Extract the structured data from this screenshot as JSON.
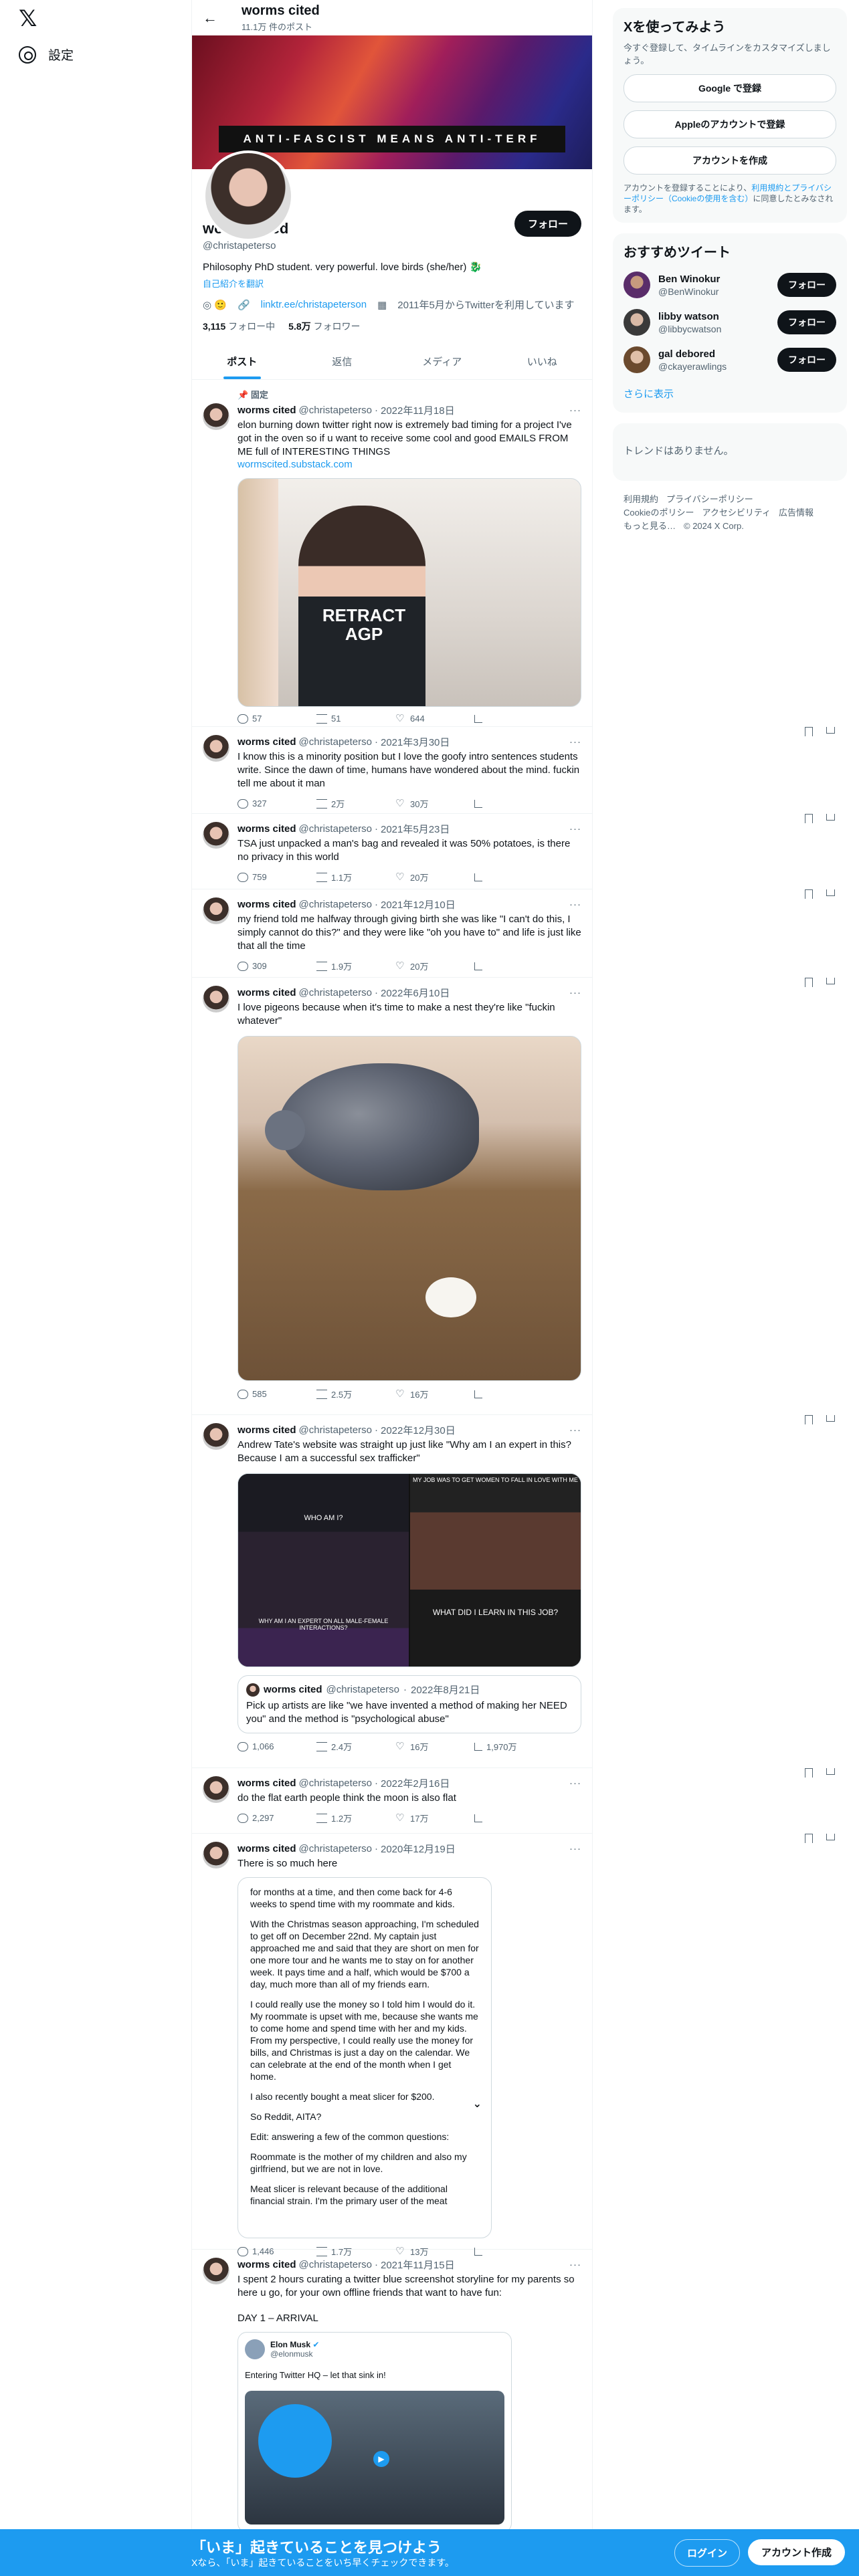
{
  "nav": {
    "settings_label": "設定"
  },
  "header": {
    "name": "worms cited",
    "post_count": "11.1万 件のポスト"
  },
  "banner": {
    "text": "ANTI-FASCIST MEANS ANTI-TERF"
  },
  "profile": {
    "name": "worms cited",
    "handle": "@christapeterso",
    "bio": "Philosophy PhD student. very powerful. love birds (she/her) 🐉",
    "translate": "自己紹介を翻訳",
    "link": "linktr.ee/christapeterson",
    "joined": "2011年5月からTwitterを利用しています",
    "following_count": "3,115",
    "following_label": "フォロー中",
    "followers_count": "5.8万",
    "followers_label": "フォロワー",
    "follow_button": "フォロー"
  },
  "tabs": [
    "ポスト",
    "返信",
    "メディア",
    "いいね"
  ],
  "pinned_label": "固定",
  "tweets": [
    {
      "name": "worms cited",
      "handle": "@christapeterso",
      "date": "2022年11月18日",
      "text": "elon burning down twitter right now is extremely bad timing for a project I've got in the oven so if u want to receive some cool and good EMAILS FROM ME full of INTERESTING THINGS",
      "link": "wormscited.substack.com",
      "image_text": "RETRACT\nAGP",
      "replies": "57",
      "retweets": "51",
      "likes": "644"
    },
    {
      "name": "worms cited",
      "handle": "@christapeterso",
      "date": "2021年3月30日",
      "text": "I know this is a minority position but I love the goofy intro sentences students write. Since the dawn of time, humans have wondered about the mind. fuckin tell me about it man",
      "replies": "327",
      "retweets": "2万",
      "likes": "30万"
    },
    {
      "name": "worms cited",
      "handle": "@christapeterso",
      "date": "2021年5月23日",
      "text": "TSA just unpacked a man's bag and revealed it was 50% potatoes, is there no privacy in this world",
      "replies": "759",
      "retweets": "1.1万",
      "likes": "20万"
    },
    {
      "name": "worms cited",
      "handle": "@christapeterso",
      "date": "2021年12月10日",
      "text": "my friend told me halfway through giving birth she was like \"I can't do this, I simply cannot do this?\" and they were like \"oh you have to\" and life is just like that all the time",
      "replies": "309",
      "retweets": "1.9万",
      "likes": "20万"
    },
    {
      "name": "worms cited",
      "handle": "@christapeterso",
      "date": "2022年6月10日",
      "text": "I love pigeons because when it's time to make a nest they're like \"fuckin whatever\"",
      "replies": "585",
      "retweets": "2.5万",
      "likes": "16万"
    },
    {
      "name": "worms cited",
      "handle": "@christapeterso",
      "date": "2022年12月30日",
      "text": "Andrew Tate's website was straight up just like \"Why am I an expert in this? Because I am a successful sex trafficker\"",
      "media_left_title": "WHO AM I?",
      "media_left_caption": "WHY AM I AN EXPERT ON ALL MALE-FEMALE INTERACTIONS?",
      "media_right_title": "MY JOB WAS TO GET WOMEN TO FALL IN LOVE WITH ME",
      "media_right_caption": "WHAT DID I LEARN IN THIS JOB?",
      "quote": {
        "name": "worms cited",
        "handle": "@christapeterso",
        "date": "2022年8月21日",
        "text": "Pick up artists are like \"we have invented a method of making her NEED you\" and the method is \"psychological abuse\""
      },
      "replies": "1,066",
      "retweets": "2.4万",
      "likes": "16万",
      "views": "1,970万"
    },
    {
      "name": "worms cited",
      "handle": "@christapeterso",
      "date": "2022年2月16日",
      "text": "do the flat earth people think the moon is also flat",
      "replies": "2,297",
      "retweets": "1.2万",
      "likes": "17万"
    },
    {
      "name": "worms cited",
      "handle": "@christapeterso",
      "date": "2020年12月19日",
      "text": "There is so much here",
      "reddit": [
        "for months at a time, and then come back for 4-6 weeks to spend time with my roommate and kids.",
        "With the Christmas season approaching, I'm scheduled to get off on December 22nd. My captain just approached me and said that they are short on men for one more tour and he wants me to stay on for another week. It pays time and a half, which would be $700 a day, much more than all of my friends earn.",
        "I could really use the money so I told him I would do it. My roommate is upset with me, because she wants me to come home and spend time with her and my kids. From my perspective, I could really use the money for bills, and Christmas is just a day on the calendar. We can celebrate at the end of the month when I get home.",
        "I also recently bought a meat slicer for $200.",
        "So Reddit, AITA?",
        "Edit: answering a few of the common questions:",
        "Roommate is the mother of my children and also my girlfriend, but we are not in love.",
        "Meat slicer is relevant because of the additional financial strain. I'm the primary user of the meat"
      ],
      "replies": "1,446",
      "retweets": "1.7万",
      "likes": "13万"
    },
    {
      "name": "worms cited",
      "handle": "@christapeterso",
      "date": "2021年11月15日",
      "text": "I spent 2 hours curating a twitter blue screenshot storyline for my parents so here u go, for your own offline friends that want to have fun:",
      "text2": "DAY 1 – ARRIVAL",
      "embed": {
        "name": "Elon Musk",
        "handle": "@elonmusk",
        "text": "Entering Twitter HQ – let that sink in!"
      }
    }
  ],
  "right": {
    "signup_title": "Xを使ってみよう",
    "signup_sub": "今すぐ登録して、タイムラインをカスタマイズしましょう。",
    "google_btn": "Google で登録",
    "apple_btn": "Appleのアカウントで登録",
    "create_btn": "アカウントを作成",
    "legal_1": "アカウントを登録することにより、",
    "legal_link": "利用規約とプライバシーポリシー（Cookieの使用を含む）",
    "legal_2": "に同意したとみなされます。",
    "recommend_title": "おすすめツイート",
    "who": [
      {
        "name": "Ben Winokur",
        "handle": "@BenWinokur",
        "button": "フォロー"
      },
      {
        "name": "libby watson",
        "handle": "@libbycwatson",
        "button": "フォロー"
      },
      {
        "name": "gal debored",
        "handle": "@ckayerawlings",
        "button": "フォロー"
      }
    ],
    "show_more": "さらに表示",
    "no_trends": "トレンドはありません。",
    "footer": [
      "利用規約",
      "プライバシーポリシー",
      "Cookieのポリシー",
      "アクセシビリティ",
      "広告情報",
      "もっと見る…",
      "© 2024 X Corp."
    ]
  },
  "bottombar": {
    "title": "「いま」起きていることを見つけよう",
    "sub": "Xなら、「いま」起きていることをいち早くチェックできます。",
    "login": "ログイン",
    "signup": "アカウント作成"
  }
}
